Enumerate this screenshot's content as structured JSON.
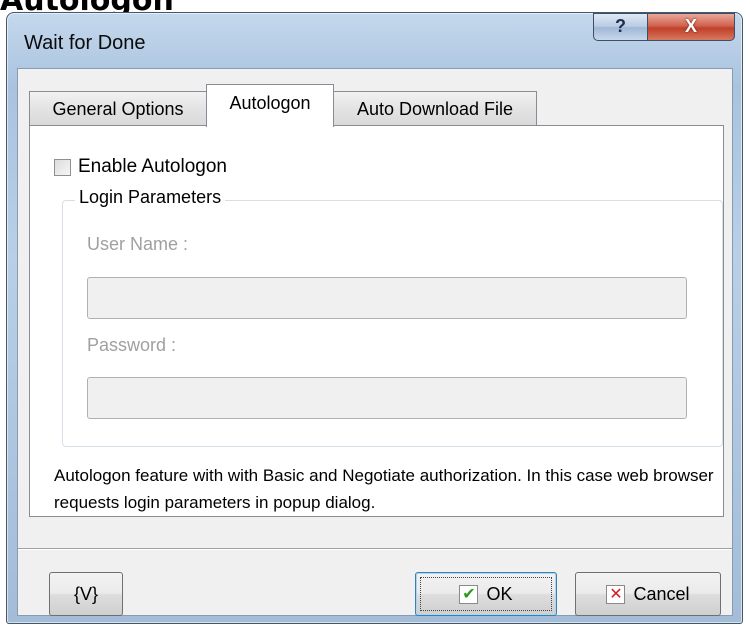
{
  "page_heading": "Autologon",
  "window": {
    "title": "Wait for Done",
    "help_label": "?",
    "close_label": "X"
  },
  "tabs": [
    {
      "label": "General Options",
      "selected": false
    },
    {
      "label": "Autologon",
      "selected": true
    },
    {
      "label": "Auto Download File",
      "selected": false
    }
  ],
  "autologon": {
    "enable_label": "Enable Autologon",
    "enable_checked": false,
    "group_title": "Login Parameters",
    "user_label": "User Name :",
    "user_value": "",
    "password_label": "Password :",
    "password_value": "",
    "info_text": "Autologon feature with with Basic and Negotiate authorization. In this case web browser requests login parameters in popup dialog."
  },
  "buttons": {
    "variables_label": "{V}",
    "ok_label": "OK",
    "cancel_label": "Cancel"
  },
  "icons": {
    "ok": "check-icon",
    "cancel": "x-icon",
    "ok_color": "#2f9a1e",
    "cancel_color": "#d21f1f"
  }
}
